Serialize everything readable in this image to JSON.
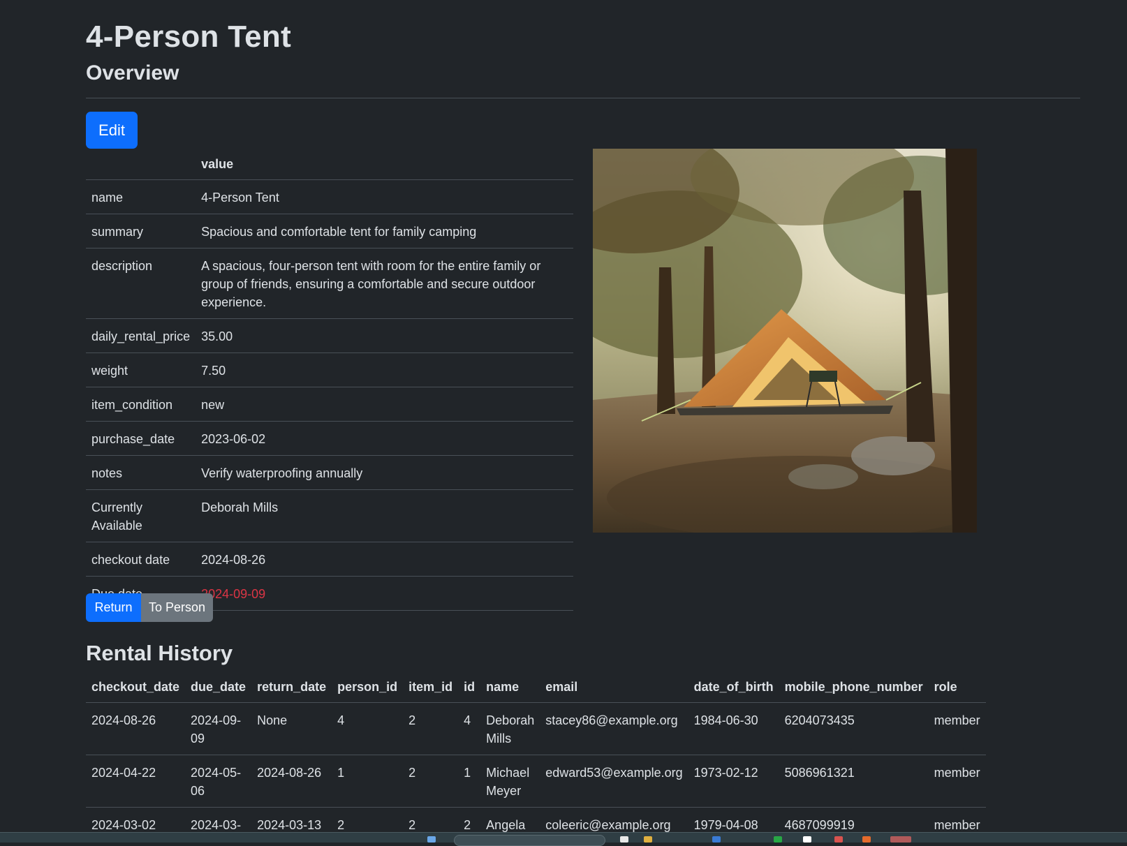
{
  "page": {
    "title": "4-Person Tent",
    "subtitle": "Overview",
    "edit_label": "Edit"
  },
  "details": {
    "header_value": "value",
    "rows": [
      {
        "key": "name",
        "value": "4-Person Tent"
      },
      {
        "key": "summary",
        "value": "Spacious and comfortable tent for family camping"
      },
      {
        "key": "description",
        "value": "A spacious, four-person tent with room for the entire family or group of friends, ensuring a comfortable and secure outdoor experience."
      },
      {
        "key": "daily_rental_price",
        "value": "35.00"
      },
      {
        "key": "weight",
        "value": "7.50"
      },
      {
        "key": "item_condition",
        "value": "new"
      },
      {
        "key": "purchase_date",
        "value": "2023-06-02"
      },
      {
        "key": "notes",
        "value": "Verify waterproofing annually"
      },
      {
        "key": "Currently Available",
        "value": "Deborah Mills"
      },
      {
        "key": "checkout date",
        "value": "2024-08-26"
      },
      {
        "key": "Due date",
        "value": "2024-09-09"
      }
    ]
  },
  "actions": {
    "return_label": "Return",
    "to_person_label": "To Person"
  },
  "history": {
    "heading": "Rental History",
    "columns": [
      "checkout_date",
      "due_date",
      "return_date",
      "person_id",
      "item_id",
      "id",
      "name",
      "email",
      "date_of_birth",
      "mobile_phone_number",
      "role"
    ],
    "rows": [
      [
        "2024-08-26",
        "2024-09-09",
        "None",
        "4",
        "2",
        "4",
        "Deborah Mills",
        "stacey86@example.org",
        "1984-06-30",
        "6204073435",
        "member"
      ],
      [
        "2024-04-22",
        "2024-05-06",
        "2024-08-26",
        "1",
        "2",
        "1",
        "Michael Meyer",
        "edward53@example.org",
        "1973-02-12",
        "5086961321",
        "member"
      ],
      [
        "2024-03-02",
        "2024-03-",
        "2024-03-13",
        "2",
        "2",
        "2",
        "Angela",
        "coleeric@example.org",
        "1979-04-08",
        "4687099919",
        "member"
      ]
    ]
  },
  "colors": {
    "background": "#212529",
    "primary": "#0d6efd",
    "secondary": "#6c757d",
    "overdue": "#dc3545"
  }
}
